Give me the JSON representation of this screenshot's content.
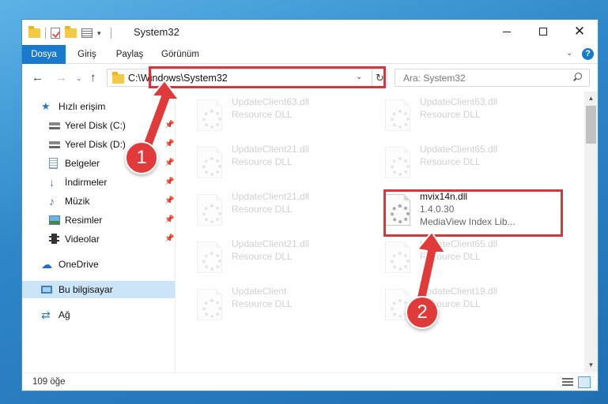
{
  "window": {
    "title": "System32",
    "controls": {
      "minimize": "—",
      "maximize": "☐",
      "close": "✕"
    }
  },
  "ribbon": {
    "tabs": [
      "Dosya",
      "Giriş",
      "Paylaş",
      "Görünüm"
    ],
    "expand_glyph": "⌄",
    "help_glyph": "?"
  },
  "navigation": {
    "back": "←",
    "forward": "→",
    "recent": "⌄",
    "up": "↑",
    "address": "C:\\Windows\\System32",
    "address_dropdown": "⌄",
    "refresh": "↻",
    "search_placeholder": "Ara: System32"
  },
  "nav_pane": {
    "quick_access": "Hızlı erişim",
    "pinned": [
      {
        "label": "Yerel Disk (C:)",
        "icon": "disk-icon"
      },
      {
        "label": "Yerel Disk (D:)",
        "icon": "disk-icon"
      },
      {
        "label": "Belgeler",
        "icon": "documents-icon"
      },
      {
        "label": "İndirmeler",
        "icon": "downloads-icon"
      },
      {
        "label": "Müzik",
        "icon": "music-icon"
      },
      {
        "label": "Resimler",
        "icon": "pictures-icon"
      },
      {
        "label": "Videolar",
        "icon": "videos-icon"
      }
    ],
    "pin_glyph": "📌",
    "onedrive": "OneDrive",
    "this_pc": "Bu bilgisayar",
    "network": "Ağ"
  },
  "files": {
    "background": [
      {
        "name": "UpdateClient63.dll",
        "type": "Resource DLL"
      },
      {
        "name": "UpdateClient63.dll",
        "type": "Resource DLL"
      },
      {
        "name": "UpdateClient21.dll",
        "type": "Resource DLL"
      },
      {
        "name": "UpdateClient65.dll",
        "type": "Resource DLL"
      },
      {
        "name": "UpdateClient21.dll",
        "type": "Resource DLL"
      },
      {
        "name": "UpdateClient65.dll",
        "type": "Resource DLL"
      },
      {
        "name": "UpdateClient21.dll",
        "type": "Resource DLL"
      },
      {
        "name": "UpdateClient",
        "type": "Resource DLL"
      },
      {
        "name": "UpdateClient19.dll",
        "type": "Resource DLL"
      }
    ],
    "highlighted": {
      "name": "mvix14n.dll",
      "version": "1.4.0.30",
      "description": "MediaView Index Lib..."
    }
  },
  "status": {
    "item_count": "109 öğe"
  },
  "annotations": {
    "step1": "1",
    "step2": "2",
    "color": "#d9343a"
  }
}
